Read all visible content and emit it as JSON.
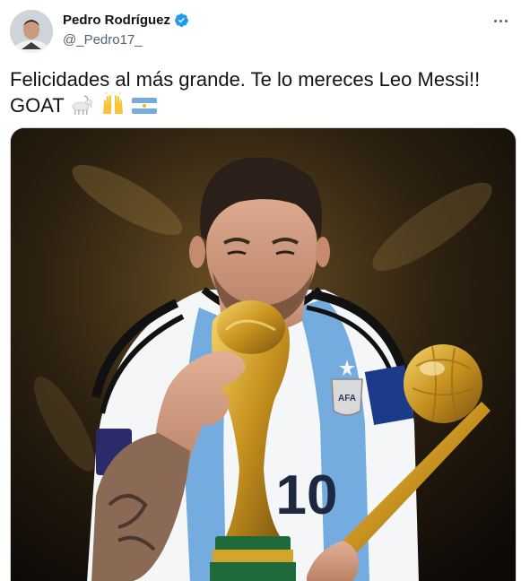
{
  "tweet": {
    "author_name": "Pedro Rodríguez",
    "author_handle": "@_Pedro17_",
    "text_line1": "Felicidades al más grande. Te lo mereces Leo Messi!!",
    "text_line2": "GOAT",
    "emojis": [
      "goat-emoji",
      "raising-hands-emoji",
      "argentina-flag-emoji"
    ],
    "media_alt_icons": [
      "trophy-icon",
      "golden-ball-icon"
    ],
    "jersey_number": "10",
    "crest_text": "AFA"
  },
  "colors": {
    "verified_blue": "#1d9bf0",
    "argentina_blue": "#74acdf",
    "gold": "#d4a52a"
  }
}
